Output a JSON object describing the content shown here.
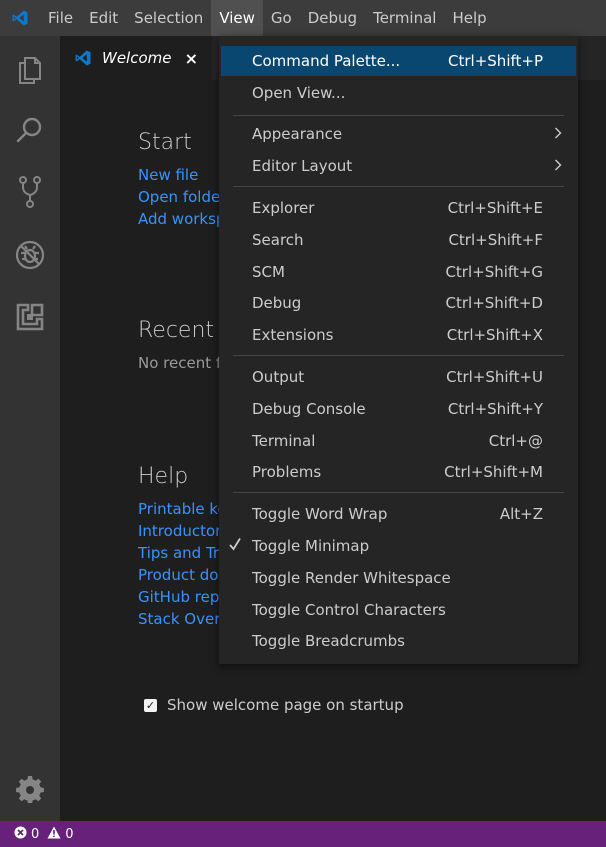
{
  "menubar": {
    "items": [
      "File",
      "Edit",
      "Selection",
      "View",
      "Go",
      "Debug",
      "Terminal",
      "Help"
    ],
    "active": "View"
  },
  "tab": {
    "label": "Welcome",
    "close": "×"
  },
  "welcome": {
    "start": {
      "title": "Start",
      "links": [
        "New file",
        "Open folde",
        "Add worksp"
      ]
    },
    "recent": {
      "title": "Recent",
      "empty": "No recent f"
    },
    "help": {
      "title": "Help",
      "links": [
        "Printable ke",
        "Introductor",
        "Tips and Tri",
        "Product doc",
        "GitHub repo",
        "Stack Overf"
      ]
    },
    "startup_label": "Show welcome page on startup",
    "startup_checked": true
  },
  "view_menu": {
    "items": [
      {
        "label": "Command Palette...",
        "shortcut": "Ctrl+Shift+P",
        "selected": true
      },
      {
        "label": "Open View...",
        "shortcut": ""
      },
      {
        "label": "Appearance",
        "submenu": true
      },
      {
        "label": "Editor Layout",
        "submenu": true
      },
      {
        "label": "Explorer",
        "shortcut": "Ctrl+Shift+E"
      },
      {
        "label": "Search",
        "shortcut": "Ctrl+Shift+F"
      },
      {
        "label": "SCM",
        "shortcut": "Ctrl+Shift+G"
      },
      {
        "label": "Debug",
        "shortcut": "Ctrl+Shift+D"
      },
      {
        "label": "Extensions",
        "shortcut": "Ctrl+Shift+X"
      },
      {
        "label": "Output",
        "shortcut": "Ctrl+Shift+U"
      },
      {
        "label": "Debug Console",
        "shortcut": "Ctrl+Shift+Y"
      },
      {
        "label": "Terminal",
        "shortcut": "Ctrl+@"
      },
      {
        "label": "Problems",
        "shortcut": "Ctrl+Shift+M"
      },
      {
        "label": "Toggle Word Wrap",
        "shortcut": "Alt+Z"
      },
      {
        "label": "Toggle Minimap",
        "shortcut": "",
        "checked": true
      },
      {
        "label": "Toggle Render Whitespace",
        "shortcut": ""
      },
      {
        "label": "Toggle Control Characters",
        "shortcut": ""
      },
      {
        "label": "Toggle Breadcrumbs",
        "shortcut": ""
      }
    ]
  },
  "statusbar": {
    "errors": "0",
    "warnings": "0"
  },
  "colors": {
    "accent": "#094771",
    "link": "#3794ff",
    "statusbar": "#68217a",
    "vscode_blue": "#0a7acc"
  }
}
